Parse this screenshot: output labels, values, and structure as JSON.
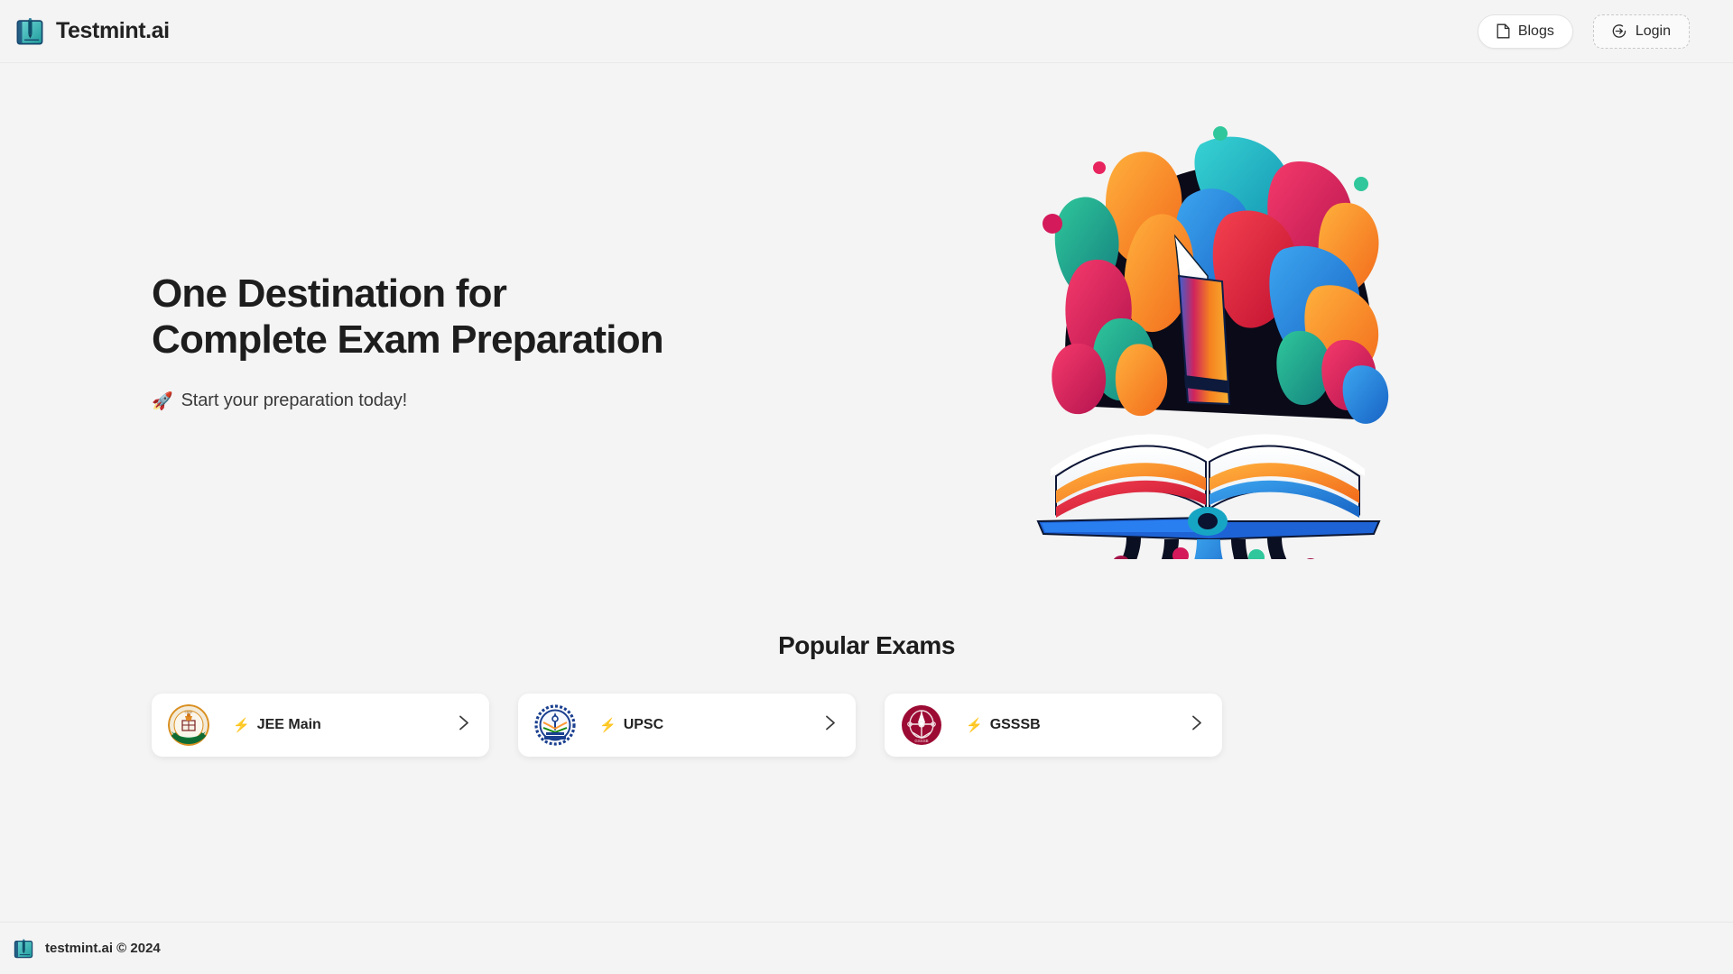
{
  "header": {
    "brand_name": "Testmint.ai",
    "brand_logo_icon": "book-pen-logo-icon",
    "buttons": [
      {
        "label": "Blogs",
        "icon": "document-icon",
        "style": "solid"
      },
      {
        "label": "Login",
        "icon": "login-arrow-icon",
        "style": "dashed"
      }
    ]
  },
  "hero": {
    "title_line1": "One Destination for",
    "title_line2": "Complete Exam Preparation",
    "subtitle_emoji": "🚀",
    "subtitle": "Start your preparation today!",
    "illustration_icon": "colorful-open-book-splash-illustration"
  },
  "exams": {
    "section_title": "Popular Exams",
    "bolt_emoji": "⚡",
    "chevron_icon": "chevron-right-icon",
    "items": [
      {
        "name": "JEE Main",
        "logo_icon": "cbse-nta-emblem-icon",
        "logo_color": "#e08a23"
      },
      {
        "name": "UPSC",
        "logo_icon": "upsc-emblem-icon",
        "logo_color": "#1a3f8f"
      },
      {
        "name": "GSSSB",
        "logo_icon": "gsssb-emblem-icon",
        "logo_color": "#9c0b33"
      }
    ]
  },
  "footer": {
    "logo_icon": "book-pen-logo-icon",
    "text": "testmint.ai © 2024"
  },
  "colors": {
    "page_background": "#f4f4f4",
    "card_background": "#ffffff",
    "text_primary": "#1d1d1d",
    "brand_teal": "#3fb8b8",
    "bolt_yellow": "#f0b400"
  }
}
